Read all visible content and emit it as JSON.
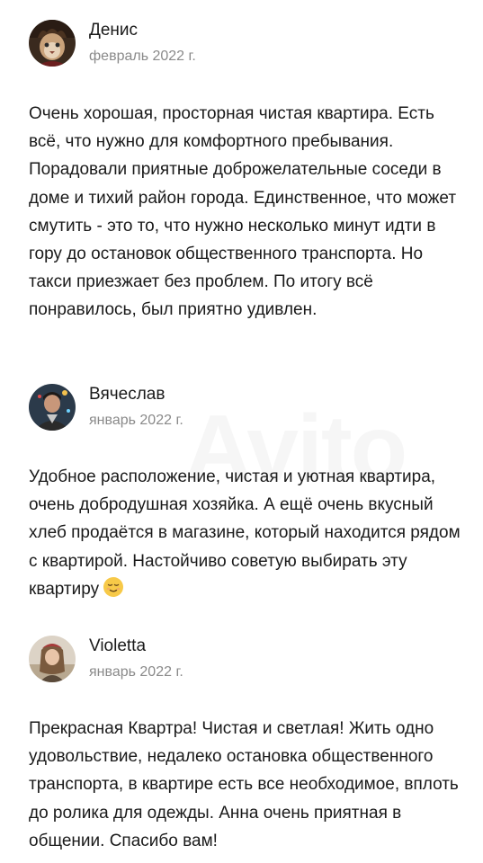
{
  "reviews": [
    {
      "author": "Денис",
      "date": "февраль 2022 г.",
      "text": "Очень хорошая, просторная чистая квартира. Есть всё, что нужно для комфортного пребывания. Порадовали приятные доброжелательные соседи в доме и тихий район города. Единственное, что может смутить - это то, что нужно несколько минут идти в гору до остановок общественного транспорта. Но такси приезжает без проблем. По итогу всё понравилось, был приятно удивлен."
    },
    {
      "author": "Вячеслав",
      "date": "январь 2022 г.",
      "text": "Удобное расположение, чистая и уютная квартира, очень добродушная хозяйка. А ещё очень вкусный хлеб продаётся в магазине, который находится рядом с квартирой. Настойчиво советую выбирать эту квартиру",
      "emoji": "relieved-face-emoji"
    },
    {
      "author": "Violetta",
      "date": "январь 2022 г.",
      "text": "Прекрасная Квартра! Чистая и светлая! Жить одно удовольствие, недалеко остановка общественного транспорта, в квартире есть все необходимое, вплоть до ролика для одежды. Анна очень приятная в общении. Спасибо вам!"
    }
  ],
  "watermark": "Avito",
  "colors": {
    "text": "#1a1a1a",
    "secondary": "#8a8a8a",
    "background": "#ffffff"
  }
}
